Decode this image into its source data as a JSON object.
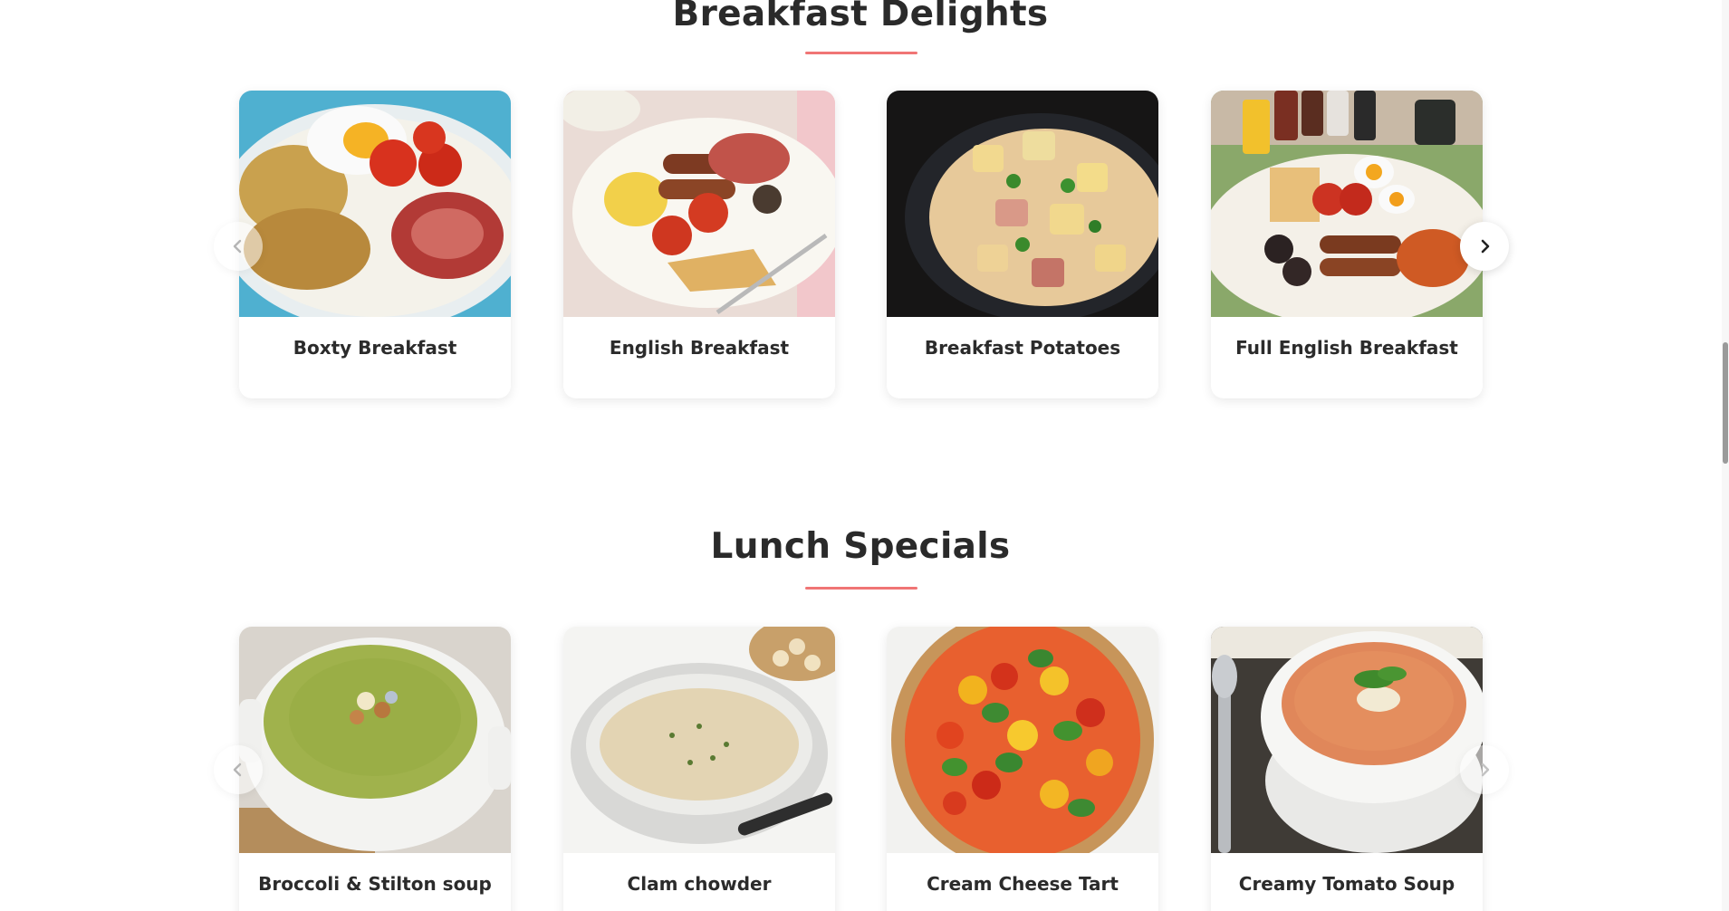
{
  "sections": [
    {
      "title": "Breakfast Delights",
      "items": [
        {
          "name": "Boxty Breakfast"
        },
        {
          "name": "English Breakfast"
        },
        {
          "name": "Breakfast Potatoes"
        },
        {
          "name": "Full English Breakfast"
        }
      ]
    },
    {
      "title": "Lunch Specials",
      "items": [
        {
          "name": "Broccoli & Stilton soup"
        },
        {
          "name": "Clam chowder"
        },
        {
          "name": "Cream Cheese Tart"
        },
        {
          "name": "Creamy Tomato Soup"
        }
      ]
    }
  ],
  "icons": {
    "prev": "chevron-left-icon",
    "next": "chevron-right-icon"
  },
  "colors": {
    "accent_underline": "#f07575",
    "title_text": "#2a2a2a",
    "card_background": "#ffffff"
  }
}
